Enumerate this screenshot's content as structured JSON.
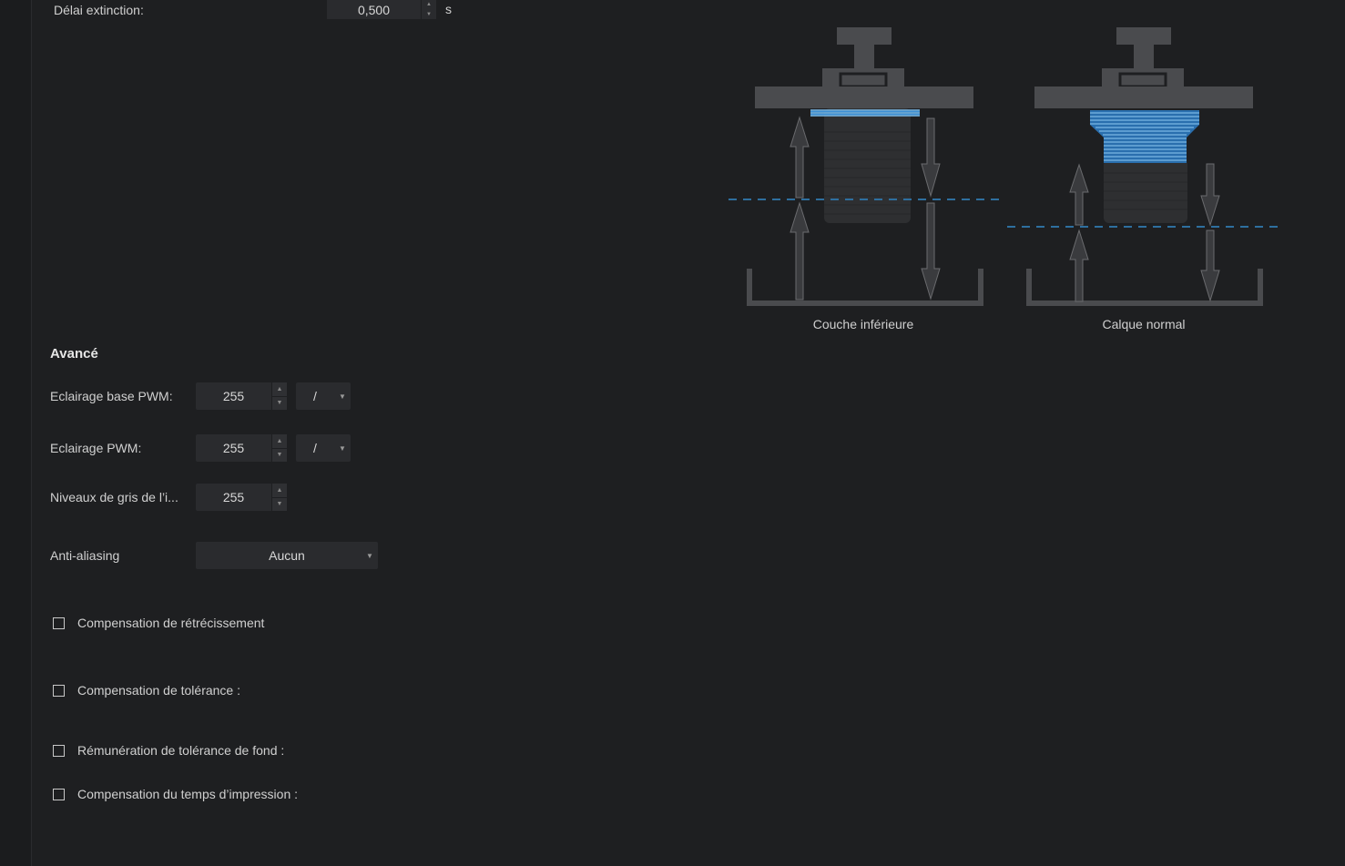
{
  "exposure": {
    "off_delay_label": "Délai extinction:",
    "off_delay_value": "0,500",
    "off_delay_unit": "s"
  },
  "diagram": {
    "bottom_caption": "Couche inférieure",
    "normal_caption": "Calque normal",
    "accent_color": "#3d8fd4"
  },
  "advanced": {
    "title": "Avancé",
    "base_pwm_label": "Eclairage base PWM:",
    "base_pwm_value": "255",
    "base_pwm_unit": "/",
    "pwm_label": "Eclairage PWM:",
    "pwm_value": "255",
    "pwm_unit": "/",
    "grey_label": "Niveaux de gris de l’i...",
    "grey_value": "255",
    "aa_label": "Anti-aliasing",
    "aa_value": "Aucun",
    "checks": [
      {
        "label": "Compensation de rétrécissement",
        "checked": false
      },
      {
        "label": "Compensation de tolérance :",
        "checked": false
      },
      {
        "label": "Rémunération de tolérance de fond :",
        "checked": false
      },
      {
        "label": "Compensation du temps d’impression :",
        "checked": false
      }
    ]
  }
}
